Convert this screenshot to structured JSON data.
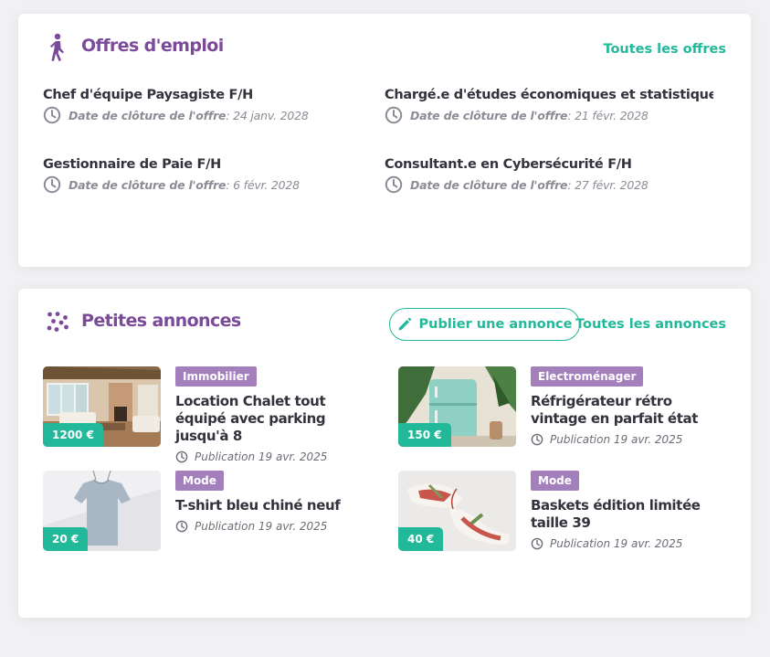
{
  "jobs_section": {
    "title": "Offres d'emploi",
    "see_all": "Toutes les offres",
    "icon": "walking-person-icon",
    "deadline_label": "Date de clôture de l'offre",
    "items": [
      {
        "title": "Chef d'équipe Paysagiste F/H",
        "deadline": ": 24 janv. 2028"
      },
      {
        "title": "Chargé.e d'études économiques et statistique...",
        "deadline": ": 21 févr. 2028"
      },
      {
        "title": "Gestionnaire de Paie F/H",
        "deadline": ": 6 févr. 2028"
      },
      {
        "title": "Consultant.e en Cybersécurité F/H",
        "deadline": ": 27 févr. 2028"
      }
    ]
  },
  "ads_section": {
    "title": "Petites annonces",
    "icon": "dots-cluster-icon",
    "publish_button": "Publier une annonce",
    "publish_icon": "pencil-icon",
    "see_all": "Toutes les annonces",
    "items": [
      {
        "category": "Immobilier",
        "title": "Location Chalet tout équipé avec parking jusqu'à 8",
        "date": "Publication 19 avr. 2025",
        "price": "1200 €",
        "image": "living-room-photo"
      },
      {
        "category": "Electroménager",
        "title": "Réfrigérateur rétro vintage en parfait état",
        "date": "Publication 19 avr. 2025",
        "price": "150 €",
        "image": "retro-fridge-photo"
      },
      {
        "category": "Mode",
        "title": "T-shirt bleu chiné neuf",
        "date": "Publication 19 avr. 2025",
        "price": "20 €",
        "image": "tshirt-photo"
      },
      {
        "category": "Mode",
        "title": "Baskets édition limitée taille 39",
        "date": "Publication 19 avr. 2025",
        "price": "40 €",
        "image": "sneakers-photo"
      }
    ]
  },
  "colors": {
    "brand_purple": "#7b4a9a",
    "accent_teal": "#22b89a",
    "badge_purple": "#a37fbb"
  }
}
